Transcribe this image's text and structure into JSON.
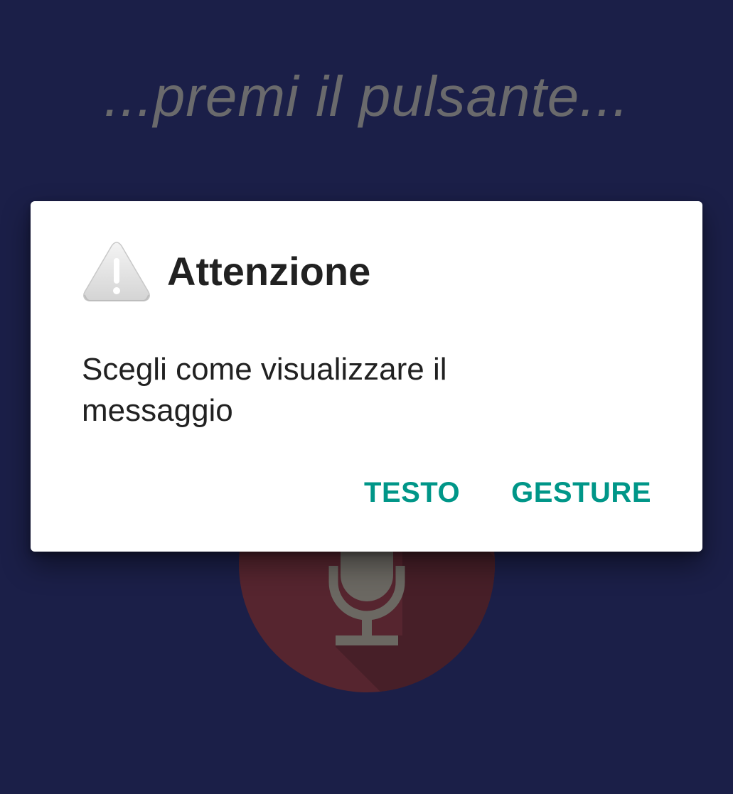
{
  "background": {
    "prompt_text": "...premi il pulsante...",
    "mic_button": {
      "icon": "microphone-icon",
      "color": "#56252f"
    }
  },
  "dialog": {
    "icon": "warning-icon",
    "title": "Attenzione",
    "message": "Scegli come visualizzare il messaggio",
    "buttons": {
      "text_label": "TESTO",
      "gesture_label": "GESTURE"
    },
    "accent_color": "#009688"
  },
  "colors": {
    "background": "#1b1f48",
    "dialog_background": "#ffffff",
    "title_text": "#212121"
  }
}
